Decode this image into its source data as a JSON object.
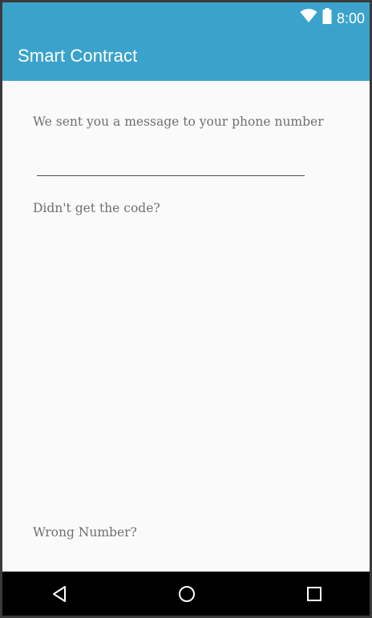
{
  "status_bar": {
    "time": "8:00",
    "icons": [
      "wifi-icon",
      "battery-icon"
    ],
    "color": "#3ba3cb"
  },
  "app_bar": {
    "title": "Smart Contract",
    "color": "#3ba3cb"
  },
  "verification": {
    "message": "We sent you a message to your phone number",
    "code_value": "",
    "resend_link": "Didn't get the code?",
    "wrong_number_link": "Wrong Number?"
  },
  "nav_bar": {
    "buttons": [
      "back-icon",
      "home-icon",
      "recents-icon"
    ]
  }
}
